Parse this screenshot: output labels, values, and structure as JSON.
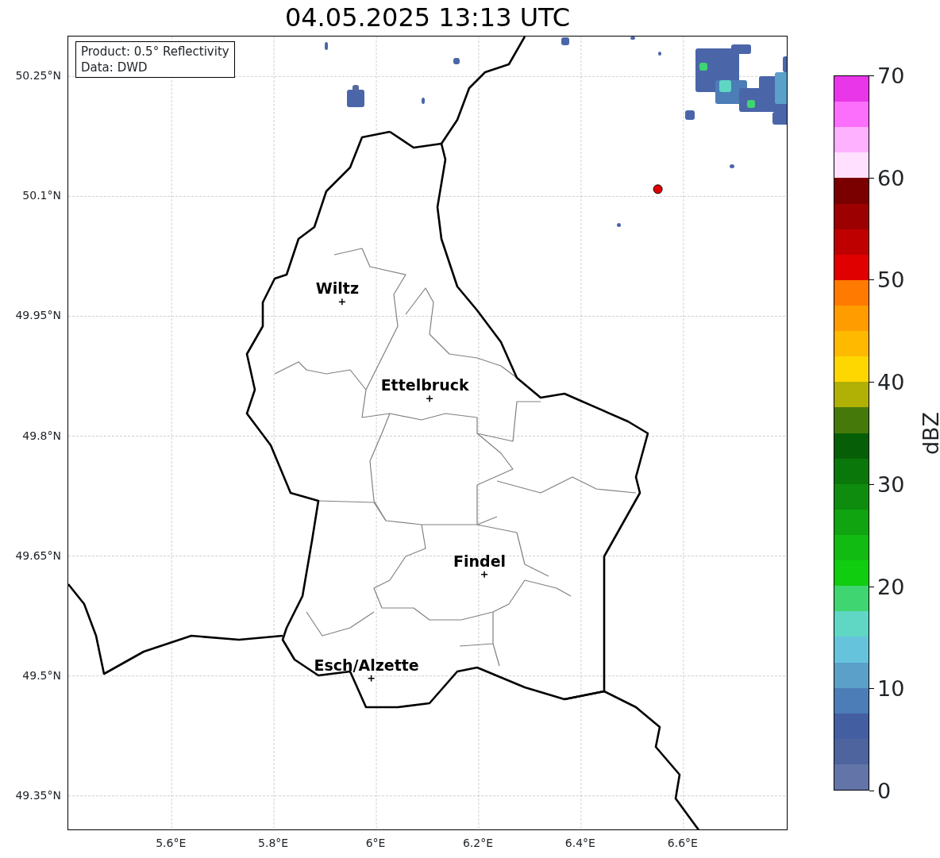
{
  "title": "04.05.2025 13:13 UTC",
  "info_box": [
    "Product: 0.5° Reflectivity",
    "Data: DWD"
  ],
  "lat_ticks": [
    {
      "label": "50.25°N"
    },
    {
      "label": "50.1°N"
    },
    {
      "label": "49.95°N"
    },
    {
      "label": "49.8°N"
    },
    {
      "label": "49.65°N"
    },
    {
      "label": "49.5°N"
    },
    {
      "label": "49.35°N"
    }
  ],
  "lon_ticks": [
    {
      "label": "5.6°E"
    },
    {
      "label": "5.8°E"
    },
    {
      "label": "6°E"
    },
    {
      "label": "6.2°E"
    },
    {
      "label": "6.4°E"
    },
    {
      "label": "6.6°E"
    }
  ],
  "cities": [
    {
      "name": "Wiltz"
    },
    {
      "name": "Ettelbruck"
    },
    {
      "name": "Findel"
    },
    {
      "name": "Esch/Alzette"
    }
  ],
  "radar_site": {
    "color": "#e00000"
  },
  "colorbar": {
    "label": "dBZ",
    "ticks": [
      "70",
      "60",
      "50",
      "40",
      "30",
      "20",
      "10",
      "0"
    ],
    "bins": [
      {
        "color": "#e936e9"
      },
      {
        "color": "#fc6efc"
      },
      {
        "color": "#feb1fe"
      },
      {
        "color": "#ffe0ff"
      },
      {
        "color": "#7a0000"
      },
      {
        "color": "#9d0000"
      },
      {
        "color": "#bf0000"
      },
      {
        "color": "#e00000"
      },
      {
        "color": "#ff7a00"
      },
      {
        "color": "#ff9c00"
      },
      {
        "color": "#ffba00"
      },
      {
        "color": "#ffd700"
      },
      {
        "color": "#b0b005"
      },
      {
        "color": "#457a0b"
      },
      {
        "color": "#065f06"
      },
      {
        "color": "#0a770a"
      },
      {
        "color": "#0d8c0d"
      },
      {
        "color": "#10a410"
      },
      {
        "color": "#12bb12"
      },
      {
        "color": "#10cd10"
      },
      {
        "color": "#3fd570"
      },
      {
        "color": "#60d6c4"
      },
      {
        "color": "#66c3dc"
      },
      {
        "color": "#5aa0c9"
      },
      {
        "color": "#4c7db6"
      },
      {
        "color": "#445ea2"
      },
      {
        "color": "#4d649e"
      },
      {
        "color": "#6374a8"
      }
    ]
  }
}
